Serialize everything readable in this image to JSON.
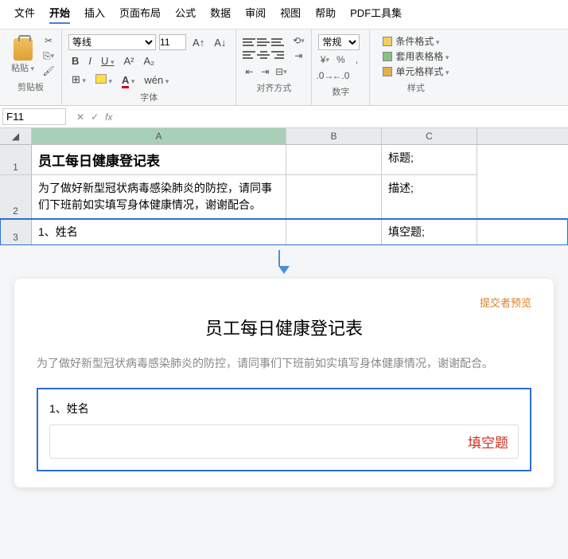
{
  "menu": {
    "items": [
      "文件",
      "开始",
      "插入",
      "页面布局",
      "公式",
      "数据",
      "审阅",
      "视图",
      "帮助",
      "PDF工具集"
    ],
    "active": 1
  },
  "ribbon": {
    "clipboard": {
      "paste": "粘贴",
      "label": "剪贴板"
    },
    "font": {
      "name": "等线",
      "size": "11",
      "label": "字体",
      "wen": "wén"
    },
    "align": {
      "label": "对齐方式"
    },
    "number": {
      "format": "常规",
      "label": "数字"
    },
    "styles": {
      "cond": "条件格式",
      "table": "套用表格格",
      "cell": "单元格样式",
      "label": "样式"
    }
  },
  "namebox": {
    "ref": "F11"
  },
  "sheet": {
    "cols": [
      "A",
      "B",
      "C"
    ],
    "rows": [
      {
        "n": "1",
        "a": "员工每日健康登记表",
        "b": "",
        "c": "标题;"
      },
      {
        "n": "2",
        "a": "为了做好新型冠状病毒感染肺炎的防控，请同事们下班前如实填写身体健康情况，谢谢配合。",
        "b": "",
        "c": "描述;"
      },
      {
        "n": "3",
        "a": "1、姓名",
        "b": "",
        "c": "填空题;"
      }
    ]
  },
  "preview": {
    "link": "提交者预览",
    "title": "员工每日健康登记表",
    "desc": "为了做好新型冠状病毒感染肺炎的防控，请同事们下班前如实填写身体健康情况，谢谢配合。",
    "q1": "1、姓名",
    "tag": "填空题"
  }
}
